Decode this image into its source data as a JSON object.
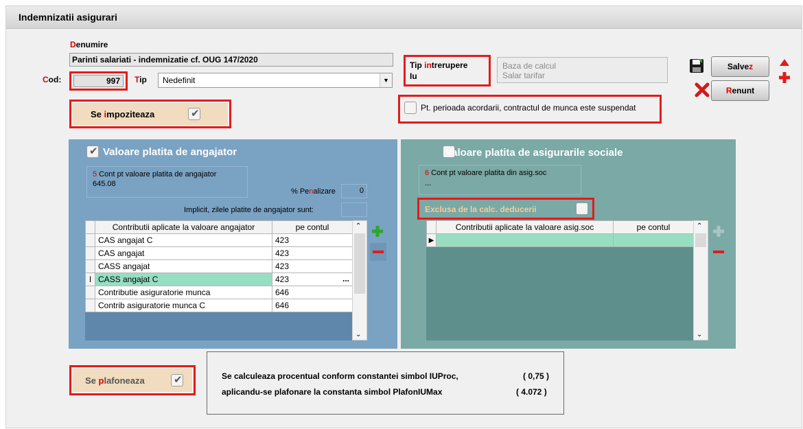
{
  "window": {
    "title": "Indemnizatii asigurari"
  },
  "denumire": {
    "label_first": "D",
    "label_rest": "enumire",
    "value": "Parinti salariati - indemnizatie cf. OUG 147/2020"
  },
  "cod": {
    "label_first": "C",
    "label_rest": "od:",
    "value": "997"
  },
  "tip": {
    "label_first": "T",
    "label_rest": "ip",
    "value": "Nedefinit"
  },
  "tip_intrerupere": {
    "label_a": "Tip ",
    "label_b": "in",
    "label_c": "trerupere",
    "value": "Iu"
  },
  "baza_calcul": {
    "label": "Baza de calcul",
    "value": "Salar tarifar"
  },
  "buttons": {
    "save_a": "Salve",
    "save_b": "z",
    "cancel_a": "R",
    "cancel_b": "enunt"
  },
  "se_impoziteaza": {
    "label_a": "Se ",
    "label_b": "i",
    "label_c": "mpoziteaza",
    "checked": true
  },
  "suspendat": {
    "label": "Pt. perioada acordarii, contractul de munca este suspendat",
    "checked": false
  },
  "left_panel": {
    "title": "Valoare platita de angajator",
    "checked": true,
    "cont_num": "5",
    "cont_label": " Cont pt valoare platita de angajator",
    "cont_value": "645.08",
    "penalizare_label_a": "% Pe",
    "penalizare_label_b": "n",
    "penalizare_label_c": "alizare",
    "penalizare_value": "0",
    "zile_label": "Implicit, zilele platite de angajator sunt:",
    "zile_value": "",
    "grid_headers": [
      "Contributii aplicate la valoare angajator",
      "pe contul"
    ],
    "rows": [
      {
        "name": "CAS angajat C",
        "cont": "423"
      },
      {
        "name": "CAS angajat",
        "cont": "423"
      },
      {
        "name": "CASS angajat",
        "cont": "423"
      },
      {
        "name": "CASS angajat C",
        "cont": "423",
        "ellipsis": "..."
      },
      {
        "name": "Contributie asiguratorie munca",
        "cont": "646"
      },
      {
        "name": "Contrib asiguratorie munca C",
        "cont": "646"
      }
    ]
  },
  "right_panel": {
    "title": "Valoare platita de asigurarile sociale",
    "checked": false,
    "cont_num": "6",
    "cont_label": " Cont pt valoare platita din asig.soc",
    "cont_value": "...",
    "exclusa_label": "Exclusa de la calc. deducerii",
    "grid_headers": [
      "Contributii aplicate la valoare asig.soc",
      "pe contul"
    ]
  },
  "se_plafoneaza": {
    "label_a": "Se ",
    "label_b": "p",
    "label_c": "lafoneaza",
    "checked": true
  },
  "info": {
    "line1": "Se calculeaza procentual conform constantei simbol IUProc,",
    "val1": "( 0,75 )",
    "line2": "aplicandu-se plafonare la  constanta simbol PlafonIUMax",
    "val2": "( 4.072 )"
  },
  "colors": {
    "accent_red": "#e21b1b",
    "left_panel": "#7aa2c3",
    "right_panel": "#7aa9a6",
    "selected_row": "#97dec3",
    "add_green": "#2fa52f"
  }
}
